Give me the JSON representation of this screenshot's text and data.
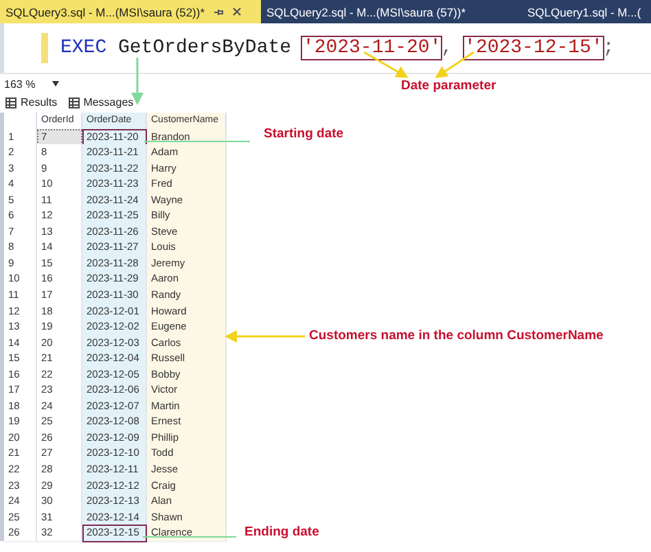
{
  "tabs": [
    {
      "label": "SQLQuery3.sql - M...(MSI\\saura (52))*",
      "selected": true
    },
    {
      "label": "SQLQuery2.sql - M...(MSI\\saura (57))*",
      "selected": false
    },
    {
      "label": "SQLQuery1.sql - M...(",
      "selected": false
    }
  ],
  "editor": {
    "tokens": [
      {
        "text": "EXEC",
        "kind": "keyword",
        "boxed": false
      },
      {
        "text": "GetOrdersByDate",
        "kind": "name",
        "boxed": false
      },
      {
        "text": "'2023-11-20'",
        "kind": "string",
        "boxed": true
      },
      {
        "text": ",",
        "kind": "punct",
        "boxed": false
      },
      {
        "text": "'2023-12-15'",
        "kind": "string",
        "boxed": true
      },
      {
        "text": ";",
        "kind": "punct",
        "boxed": false
      }
    ]
  },
  "zoom": "163 %",
  "result_tabs": [
    "Results",
    "Messages"
  ],
  "table": {
    "columns": [
      {
        "label": "OrderId",
        "color": "#ffffff"
      },
      {
        "label": "OrderDate",
        "color": "#e3f2f8"
      },
      {
        "label": "CustomerName",
        "color": "#fdf8e6"
      }
    ],
    "rows": [
      {
        "number": "1",
        "cells": [
          "7",
          "2023-11-20",
          "Brandon"
        ],
        "selected": true,
        "boxed": true
      },
      {
        "number": "2",
        "cells": [
          "8",
          "2023-11-21",
          "Adam"
        ],
        "selected": false,
        "boxed": false
      },
      {
        "number": "3",
        "cells": [
          "9",
          "2023-11-22",
          "Harry"
        ],
        "selected": false,
        "boxed": false
      },
      {
        "number": "4",
        "cells": [
          "10",
          "2023-11-23",
          "Fred"
        ],
        "selected": false,
        "boxed": false
      },
      {
        "number": "5",
        "cells": [
          "11",
          "2023-11-24",
          "Wayne"
        ],
        "selected": false,
        "boxed": false
      },
      {
        "number": "6",
        "cells": [
          "12",
          "2023-11-25",
          "Billy"
        ],
        "selected": false,
        "boxed": false
      },
      {
        "number": "7",
        "cells": [
          "13",
          "2023-11-26",
          "Steve"
        ],
        "selected": false,
        "boxed": false
      },
      {
        "number": "8",
        "cells": [
          "14",
          "2023-11-27",
          "Louis"
        ],
        "selected": false,
        "boxed": false
      },
      {
        "number": "9",
        "cells": [
          "15",
          "2023-11-28",
          "Jeremy"
        ],
        "selected": false,
        "boxed": false
      },
      {
        "number": "10",
        "cells": [
          "16",
          "2023-11-29",
          "Aaron"
        ],
        "selected": false,
        "boxed": false
      },
      {
        "number": "11",
        "cells": [
          "17",
          "2023-11-30",
          "Randy"
        ],
        "selected": false,
        "boxed": false
      },
      {
        "number": "12",
        "cells": [
          "18",
          "2023-12-01",
          "Howard"
        ],
        "selected": false,
        "boxed": false
      },
      {
        "number": "13",
        "cells": [
          "19",
          "2023-12-02",
          "Eugene"
        ],
        "selected": false,
        "boxed": false
      },
      {
        "number": "14",
        "cells": [
          "20",
          "2023-12-03",
          "Carlos"
        ],
        "selected": false,
        "boxed": false
      },
      {
        "number": "15",
        "cells": [
          "21",
          "2023-12-04",
          "Russell"
        ],
        "selected": false,
        "boxed": false
      },
      {
        "number": "16",
        "cells": [
          "22",
          "2023-12-05",
          "Bobby"
        ],
        "selected": false,
        "boxed": false
      },
      {
        "number": "17",
        "cells": [
          "23",
          "2023-12-06",
          "Victor"
        ],
        "selected": false,
        "boxed": false
      },
      {
        "number": "18",
        "cells": [
          "24",
          "2023-12-07",
          "Martin"
        ],
        "selected": false,
        "boxed": false
      },
      {
        "number": "19",
        "cells": [
          "25",
          "2023-12-08",
          "Ernest"
        ],
        "selected": false,
        "boxed": false
      },
      {
        "number": "20",
        "cells": [
          "26",
          "2023-12-09",
          "Phillip"
        ],
        "selected": false,
        "boxed": false
      },
      {
        "number": "21",
        "cells": [
          "27",
          "2023-12-10",
          "Todd"
        ],
        "selected": false,
        "boxed": false
      },
      {
        "number": "22",
        "cells": [
          "28",
          "2023-12-11",
          "Jesse"
        ],
        "selected": false,
        "boxed": false
      },
      {
        "number": "23",
        "cells": [
          "29",
          "2023-12-12",
          "Craig"
        ],
        "selected": false,
        "boxed": false
      },
      {
        "number": "24",
        "cells": [
          "30",
          "2023-12-13",
          "Alan"
        ],
        "selected": false,
        "boxed": false
      },
      {
        "number": "25",
        "cells": [
          "31",
          "2023-12-14",
          "Shawn"
        ],
        "selected": false,
        "boxed": false
      },
      {
        "number": "26",
        "cells": [
          "32",
          "2023-12-15",
          "Clarence"
        ],
        "selected": false,
        "boxed": true
      }
    ]
  },
  "annotations": [
    "Date parameter",
    "Starting date",
    "Customers name in the column CustomerName",
    "Ending date"
  ]
}
